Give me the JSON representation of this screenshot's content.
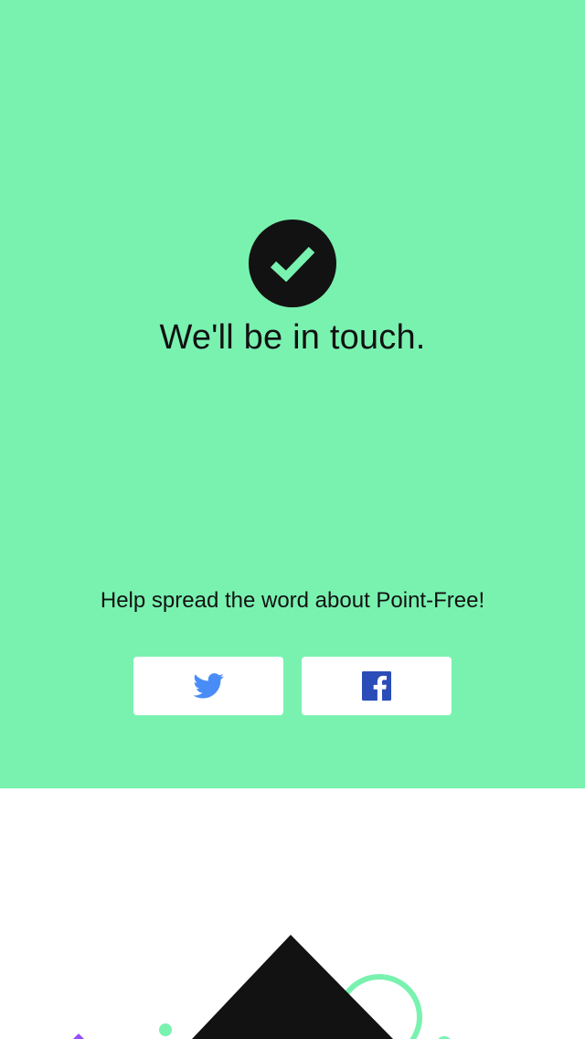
{
  "confirmation": {
    "headline": "We'll be in touch.",
    "icon": "checkmark-icon"
  },
  "share": {
    "prompt": "Help spread the word about Point-Free!",
    "buttons": [
      {
        "network": "twitter",
        "icon": "twitter-icon",
        "color": "#4a8cf7"
      },
      {
        "network": "facebook",
        "icon": "facebook-icon",
        "color": "#2a4db8"
      }
    ]
  },
  "colors": {
    "brand_green": "#79f2b0",
    "ink": "#121212",
    "white": "#ffffff",
    "accent_purple": "#974dff"
  }
}
